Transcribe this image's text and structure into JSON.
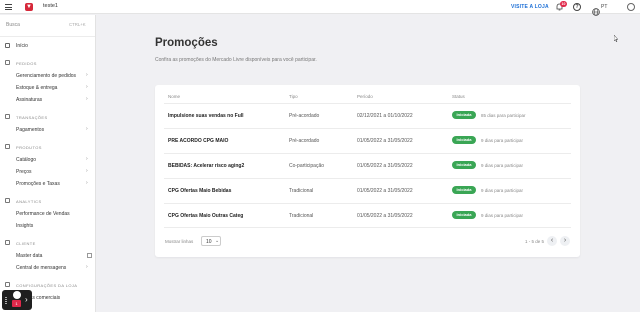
{
  "topbar": {
    "store_name": "teste1",
    "visit_store": "VISITE A LOJA",
    "notif_count": "10",
    "language": "PT",
    "help_glyph": "?"
  },
  "sidebar": {
    "search_label": "Busca",
    "search_shortcut": "CTRL+K",
    "items": {
      "inicio": "Início",
      "pedidos_section": "PEDIDOS",
      "gerenciamento": "Gerenciamento de pedidos",
      "estoque": "Estoque & entrega",
      "assinaturas": "Assinaturas",
      "transacoes_section": "TRANSAÇÕES",
      "pagamentos": "Pagamentos",
      "produtos_section": "PRODUTOS",
      "catalogo": "Catálogo",
      "precos": "Preços",
      "promocoes": "Promoções e Taxas",
      "analytics_section": "ANALYTICS",
      "performance": "Performance de Vendas",
      "insights": "Insights",
      "cliente_section": "CLIENTE",
      "master_data": "Master data",
      "central": "Central de mensagens",
      "config_section": "CONFIGURAÇÕES DA LOJA",
      "politicas": "Políticas comerciais"
    }
  },
  "fab": {
    "badge": "1"
  },
  "main": {
    "title": "Promoções",
    "subtitle": "Confira as promoções do Mercado Livre disponíveis para você participar.",
    "columns": {
      "name": "Nome",
      "type": "Tipo",
      "period": "Período",
      "status": "Status"
    },
    "rows": [
      {
        "name": "Impulsione suas vendas no Full",
        "type": "Pré-acordado",
        "period": "02/12/2021 a 01/10/2022",
        "status": "Iniciada",
        "days": "85 dias para participar"
      },
      {
        "name": "PRE ACORDO CPG MAIO",
        "type": "Pré-acordado",
        "period": "01/05/2022 a 31/05/2022",
        "status": "Iniciada",
        "days": "9 dias para participar"
      },
      {
        "name": "BEBIDAS: Acelerar risco aging2",
        "type": "Co-participação",
        "period": "01/05/2022 a 31/05/2022",
        "status": "Iniciada",
        "days": "9 dias para participar"
      },
      {
        "name": "CPG Ofertas Maio Bebidas",
        "type": "Tradicional",
        "period": "01/05/2022 a 31/05/2022",
        "status": "Iniciada",
        "days": "9 dias para participar"
      },
      {
        "name": "CPG Ofertas Maio Outras Categ",
        "type": "Tradicional",
        "period": "01/05/2022 a 31/05/2022",
        "status": "Iniciada",
        "days": "9 dias para participar"
      }
    ],
    "footer": {
      "show_rows_label": "Mostrar linhas",
      "rows_value": "10",
      "page_info": "1 - 5 de 5",
      "prev": "‹",
      "next": "›",
      "select_chevron": "⌄"
    }
  },
  "colors": {
    "accent_link": "#1c6fd6",
    "status_green": "#3aa655",
    "brand_red": "#d6283a",
    "badge_red": "#e0284a"
  }
}
